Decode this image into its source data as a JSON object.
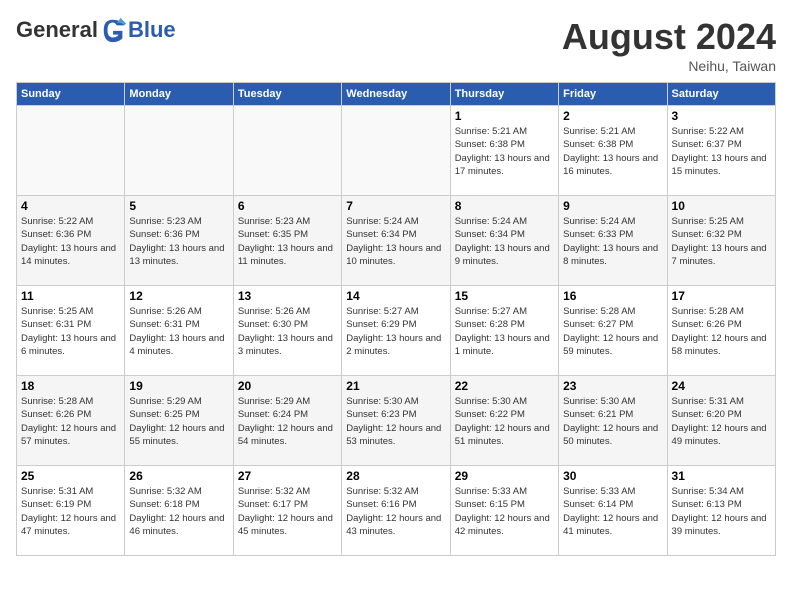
{
  "header": {
    "logo_general": "General",
    "logo_blue": "Blue",
    "month_year": "August 2024",
    "location": "Neihu, Taiwan"
  },
  "days_of_week": [
    "Sunday",
    "Monday",
    "Tuesday",
    "Wednesday",
    "Thursday",
    "Friday",
    "Saturday"
  ],
  "weeks": [
    [
      {
        "day": "",
        "info": ""
      },
      {
        "day": "",
        "info": ""
      },
      {
        "day": "",
        "info": ""
      },
      {
        "day": "",
        "info": ""
      },
      {
        "day": "1",
        "info": "Sunrise: 5:21 AM\nSunset: 6:38 PM\nDaylight: 13 hours and 17 minutes."
      },
      {
        "day": "2",
        "info": "Sunrise: 5:21 AM\nSunset: 6:38 PM\nDaylight: 13 hours and 16 minutes."
      },
      {
        "day": "3",
        "info": "Sunrise: 5:22 AM\nSunset: 6:37 PM\nDaylight: 13 hours and 15 minutes."
      }
    ],
    [
      {
        "day": "4",
        "info": "Sunrise: 5:22 AM\nSunset: 6:36 PM\nDaylight: 13 hours and 14 minutes."
      },
      {
        "day": "5",
        "info": "Sunrise: 5:23 AM\nSunset: 6:36 PM\nDaylight: 13 hours and 13 minutes."
      },
      {
        "day": "6",
        "info": "Sunrise: 5:23 AM\nSunset: 6:35 PM\nDaylight: 13 hours and 11 minutes."
      },
      {
        "day": "7",
        "info": "Sunrise: 5:24 AM\nSunset: 6:34 PM\nDaylight: 13 hours and 10 minutes."
      },
      {
        "day": "8",
        "info": "Sunrise: 5:24 AM\nSunset: 6:34 PM\nDaylight: 13 hours and 9 minutes."
      },
      {
        "day": "9",
        "info": "Sunrise: 5:24 AM\nSunset: 6:33 PM\nDaylight: 13 hours and 8 minutes."
      },
      {
        "day": "10",
        "info": "Sunrise: 5:25 AM\nSunset: 6:32 PM\nDaylight: 13 hours and 7 minutes."
      }
    ],
    [
      {
        "day": "11",
        "info": "Sunrise: 5:25 AM\nSunset: 6:31 PM\nDaylight: 13 hours and 6 minutes."
      },
      {
        "day": "12",
        "info": "Sunrise: 5:26 AM\nSunset: 6:31 PM\nDaylight: 13 hours and 4 minutes."
      },
      {
        "day": "13",
        "info": "Sunrise: 5:26 AM\nSunset: 6:30 PM\nDaylight: 13 hours and 3 minutes."
      },
      {
        "day": "14",
        "info": "Sunrise: 5:27 AM\nSunset: 6:29 PM\nDaylight: 13 hours and 2 minutes."
      },
      {
        "day": "15",
        "info": "Sunrise: 5:27 AM\nSunset: 6:28 PM\nDaylight: 13 hours and 1 minute."
      },
      {
        "day": "16",
        "info": "Sunrise: 5:28 AM\nSunset: 6:27 PM\nDaylight: 12 hours and 59 minutes."
      },
      {
        "day": "17",
        "info": "Sunrise: 5:28 AM\nSunset: 6:26 PM\nDaylight: 12 hours and 58 minutes."
      }
    ],
    [
      {
        "day": "18",
        "info": "Sunrise: 5:28 AM\nSunset: 6:26 PM\nDaylight: 12 hours and 57 minutes."
      },
      {
        "day": "19",
        "info": "Sunrise: 5:29 AM\nSunset: 6:25 PM\nDaylight: 12 hours and 55 minutes."
      },
      {
        "day": "20",
        "info": "Sunrise: 5:29 AM\nSunset: 6:24 PM\nDaylight: 12 hours and 54 minutes."
      },
      {
        "day": "21",
        "info": "Sunrise: 5:30 AM\nSunset: 6:23 PM\nDaylight: 12 hours and 53 minutes."
      },
      {
        "day": "22",
        "info": "Sunrise: 5:30 AM\nSunset: 6:22 PM\nDaylight: 12 hours and 51 minutes."
      },
      {
        "day": "23",
        "info": "Sunrise: 5:30 AM\nSunset: 6:21 PM\nDaylight: 12 hours and 50 minutes."
      },
      {
        "day": "24",
        "info": "Sunrise: 5:31 AM\nSunset: 6:20 PM\nDaylight: 12 hours and 49 minutes."
      }
    ],
    [
      {
        "day": "25",
        "info": "Sunrise: 5:31 AM\nSunset: 6:19 PM\nDaylight: 12 hours and 47 minutes."
      },
      {
        "day": "26",
        "info": "Sunrise: 5:32 AM\nSunset: 6:18 PM\nDaylight: 12 hours and 46 minutes."
      },
      {
        "day": "27",
        "info": "Sunrise: 5:32 AM\nSunset: 6:17 PM\nDaylight: 12 hours and 45 minutes."
      },
      {
        "day": "28",
        "info": "Sunrise: 5:32 AM\nSunset: 6:16 PM\nDaylight: 12 hours and 43 minutes."
      },
      {
        "day": "29",
        "info": "Sunrise: 5:33 AM\nSunset: 6:15 PM\nDaylight: 12 hours and 42 minutes."
      },
      {
        "day": "30",
        "info": "Sunrise: 5:33 AM\nSunset: 6:14 PM\nDaylight: 12 hours and 41 minutes."
      },
      {
        "day": "31",
        "info": "Sunrise: 5:34 AM\nSunset: 6:13 PM\nDaylight: 12 hours and 39 minutes."
      }
    ]
  ]
}
